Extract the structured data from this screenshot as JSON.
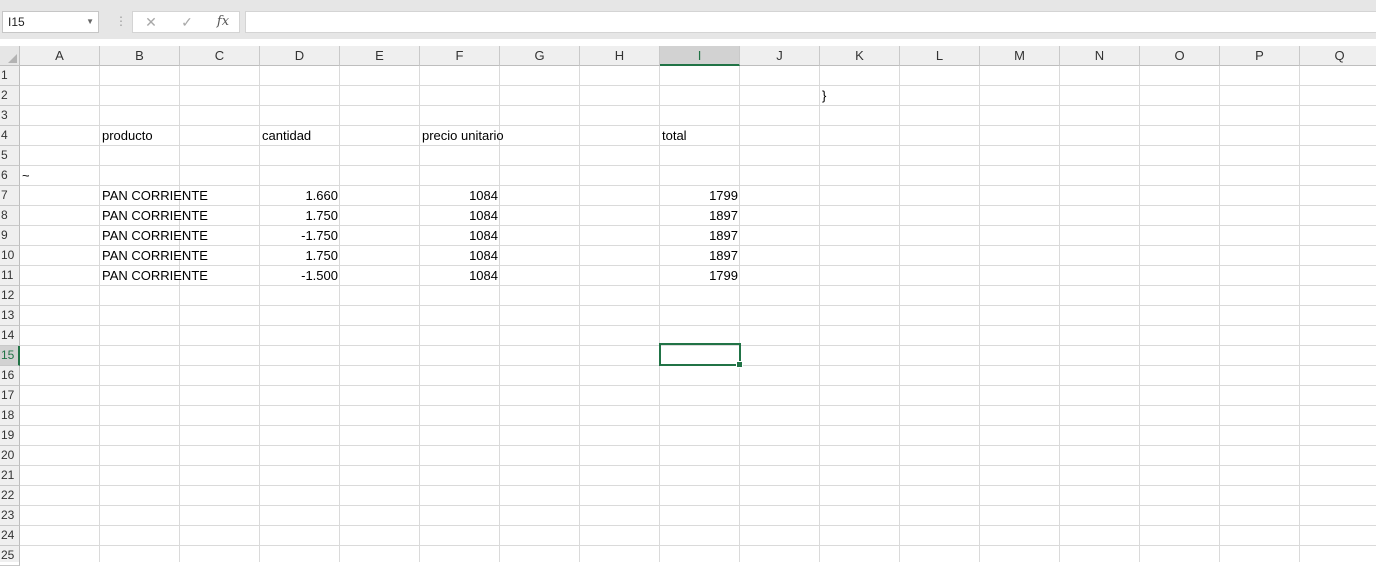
{
  "formula_bar": {
    "name_box": "I15",
    "separator": "⋮",
    "cancel": "✕",
    "enter": "✓",
    "fx": "fx",
    "content": ""
  },
  "columns": [
    "A",
    "B",
    "C",
    "D",
    "E",
    "F",
    "G",
    "H",
    "I",
    "J",
    "K",
    "L",
    "M",
    "N",
    "O",
    "P",
    "Q"
  ],
  "rows": [
    "1",
    "2",
    "3",
    "4",
    "5",
    "6",
    "7",
    "8",
    "9",
    "10",
    "11",
    "12",
    "13",
    "14",
    "15",
    "16",
    "17",
    "18",
    "19",
    "20",
    "21",
    "22",
    "23",
    "24",
    "25"
  ],
  "selected_cell": {
    "ref": "I15",
    "column": "I",
    "row": "15"
  },
  "cells": {
    "K2": "}",
    "B4": "producto",
    "D4": "cantidad",
    "F4": "precio unitario",
    "I4": "total",
    "A6": "~",
    "B7": "PAN CORRIENTE",
    "D7": "1.660",
    "F7": "1084",
    "I7": "1799",
    "B8": "PAN CORRIENTE",
    "D8": "1.750",
    "F8": "1084",
    "I8": "1897",
    "B9": "PAN CORRIENTE",
    "D9": "-1.750",
    "F9": "1084",
    "I9": "1897",
    "B10": "PAN CORRIENTE",
    "D10": "1.750",
    "F10": "1084",
    "I10": "1897",
    "B11": "PAN CORRIENTE",
    "D11": "-1.500",
    "F11": "1084",
    "I11": "1799"
  },
  "colors": {
    "accent": "#217346",
    "gridline": "#dadada",
    "header_bg": "#efefef"
  }
}
